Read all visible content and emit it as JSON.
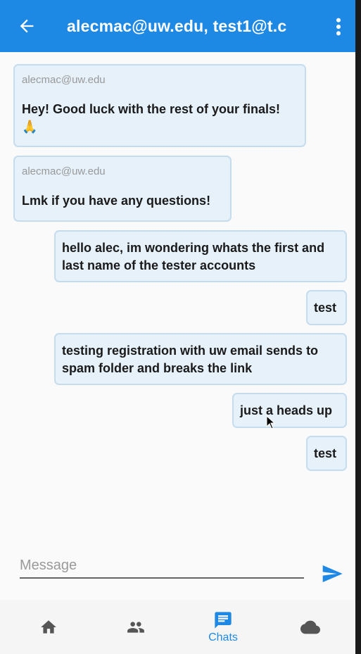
{
  "appbar": {
    "title": "alecmac@uw.edu, test1@t.c"
  },
  "messages": [
    {
      "sender": "alecmac@uw.edu",
      "text": "Hey! Good luck with the rest of your finals! 🙏",
      "incoming": true
    },
    {
      "sender": "alecmac@uw.edu",
      "text": "Lmk if you have any questions!",
      "incoming": true
    },
    {
      "text": "hello alec, im wondering whats the first and last name of the tester accounts",
      "incoming": false
    },
    {
      "text": "test",
      "incoming": false
    },
    {
      "text": "testing registration with uw email sends to spam folder and breaks the link",
      "incoming": false
    },
    {
      "text": "just a heads up",
      "incoming": false
    },
    {
      "text": "test",
      "incoming": false
    }
  ],
  "composer": {
    "placeholder": "Message"
  },
  "nav": {
    "chats_label": "Chats"
  },
  "colors": {
    "primary": "#1e88e5",
    "bubble_bg": "#e6f1fa"
  }
}
